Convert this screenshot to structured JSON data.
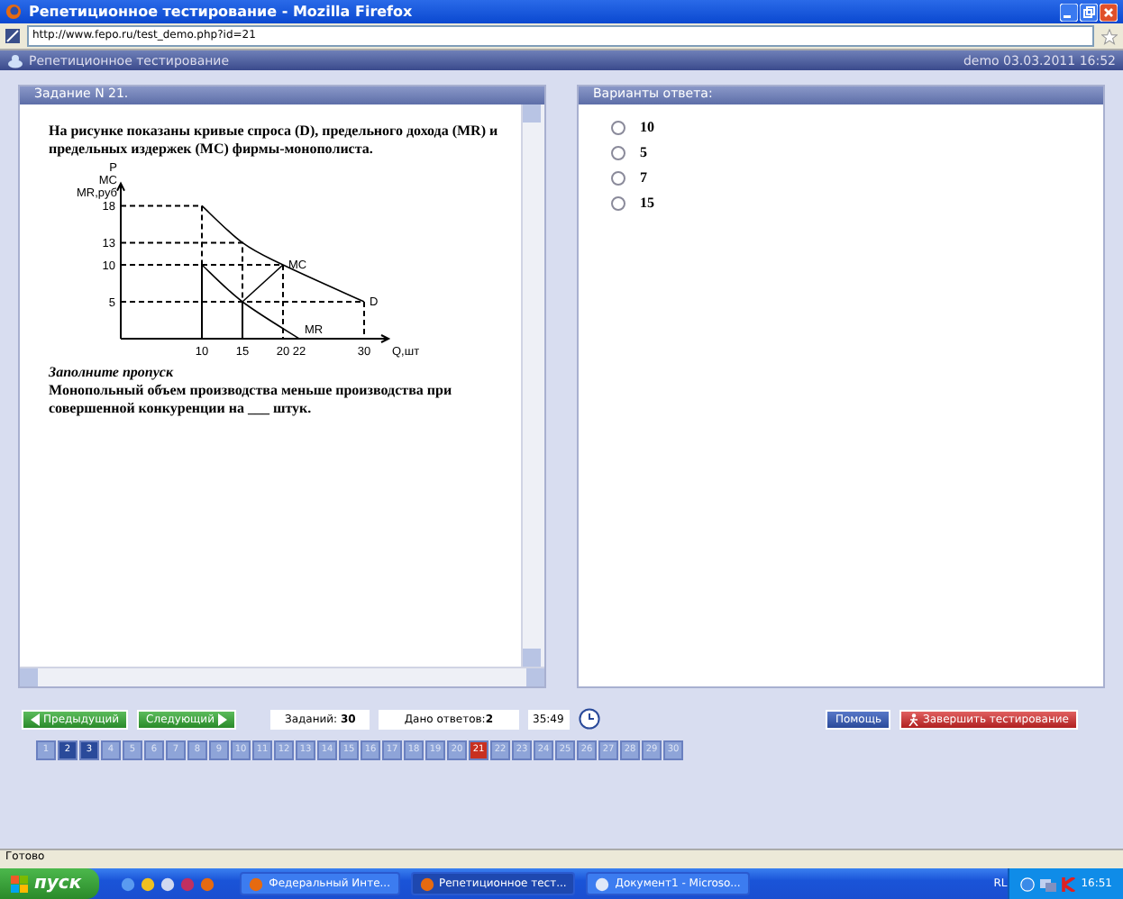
{
  "window": {
    "title": "Репетиционное тестирование - Mozilla Firefox"
  },
  "address_bar": {
    "url": "http://www.fepo.ru/test_demo.php?id=21"
  },
  "app_header": {
    "title": "Репетиционное тестирование",
    "info": "demo 03.03.2011 16:52"
  },
  "question_panel": {
    "title": "Задание N 21.",
    "text": "На рисунке показаны кривые спроса (D), предельного дохода (MR) и предельных издержек (MC) фирмы-монополиста.",
    "chart_data": {
      "type": "line",
      "xlabel": "Q,шт",
      "ylabel": "P\nMC\nMR,руб",
      "x": [
        10,
        15,
        20,
        22,
        30
      ],
      "series": [
        {
          "name": "D",
          "color": "#000000",
          "values": [
            18,
            13,
            10,
            null,
            5
          ]
        },
        {
          "name": "MR",
          "color": "#000000",
          "values": [
            10,
            5,
            null,
            0,
            null
          ]
        },
        {
          "name": "MC",
          "color": "#000000",
          "values": [
            null,
            5,
            10,
            null,
            null
          ]
        }
      ],
      "xticks": [
        10,
        15,
        20,
        22,
        30
      ],
      "yticks": [
        5,
        10,
        13,
        18
      ],
      "xlim": [
        0,
        33
      ],
      "ylim": [
        0,
        21
      ]
    },
    "instruction": "Заполните пропуск",
    "body": "Монопольный объем производства меньше производства при совершенной конкуренции на ___ штук."
  },
  "answer_panel": {
    "title": "Варианты ответа:",
    "options": [
      {
        "label": "10",
        "selected": false
      },
      {
        "label": "5",
        "selected": false
      },
      {
        "label": "7",
        "selected": false
      },
      {
        "label": "15",
        "selected": false
      }
    ]
  },
  "navigation": {
    "prev": "Предыдущий",
    "next": "Следующий",
    "tasks": "Заданий: **30**",
    "answered": "Дано ответов:**2**",
    "timer": "35:49",
    "help": "Помощь",
    "finish": "Завершить тестирование"
  },
  "pages": [
    {
      "label": "1",
      "answered": false,
      "selected": false
    },
    {
      "label": "2",
      "answered": true,
      "selected": false
    },
    {
      "label": "3",
      "answered": true,
      "selected": false
    },
    {
      "label": "4",
      "answered": false,
      "selected": false
    },
    {
      "label": "5",
      "answered": false,
      "selected": false
    },
    {
      "label": "6",
      "answered": false,
      "selected": false
    },
    {
      "label": "7",
      "answered": false,
      "selected": false
    },
    {
      "label": "8",
      "answered": false,
      "selected": false
    },
    {
      "label": "9",
      "answered": false,
      "selected": false
    },
    {
      "label": "10",
      "answered": false,
      "selected": false
    },
    {
      "label": "11",
      "answered": false,
      "selected": false
    },
    {
      "label": "12",
      "answered": false,
      "selected": false
    },
    {
      "label": "13",
      "answered": false,
      "selected": false
    },
    {
      "label": "14",
      "answered": false,
      "selected": false
    },
    {
      "label": "15",
      "answered": false,
      "selected": false
    },
    {
      "label": "16",
      "answered": false,
      "selected": false
    },
    {
      "label": "17",
      "answered": false,
      "selected": false
    },
    {
      "label": "18",
      "answered": false,
      "selected": false
    },
    {
      "label": "19",
      "answered": false,
      "selected": false
    },
    {
      "label": "20",
      "answered": false,
      "selected": false
    },
    {
      "label": "21",
      "answered": false,
      "selected": true
    },
    {
      "label": "22",
      "answered": false,
      "selected": false
    },
    {
      "label": "23",
      "answered": false,
      "selected": false
    },
    {
      "label": "24",
      "answered": false,
      "selected": false
    },
    {
      "label": "25",
      "answered": false,
      "selected": false
    },
    {
      "label": "26",
      "answered": false,
      "selected": false
    },
    {
      "label": "27",
      "answered": false,
      "selected": false
    },
    {
      "label": "28",
      "answered": false,
      "selected": false
    },
    {
      "label": "29",
      "answered": false,
      "selected": false
    },
    {
      "label": "30",
      "answered": false,
      "selected": false
    }
  ],
  "status_bar": {
    "text": "Готово"
  },
  "taskbar": {
    "start": "пуск",
    "tasks": [
      {
        "label": "Федеральный Инте...",
        "selected": false
      },
      {
        "label": "Репетиционное тест...",
        "selected": true
      },
      {
        "label": "Документ1 - Microso...",
        "selected": false
      }
    ],
    "language": "RL",
    "clock": "16:51"
  }
}
